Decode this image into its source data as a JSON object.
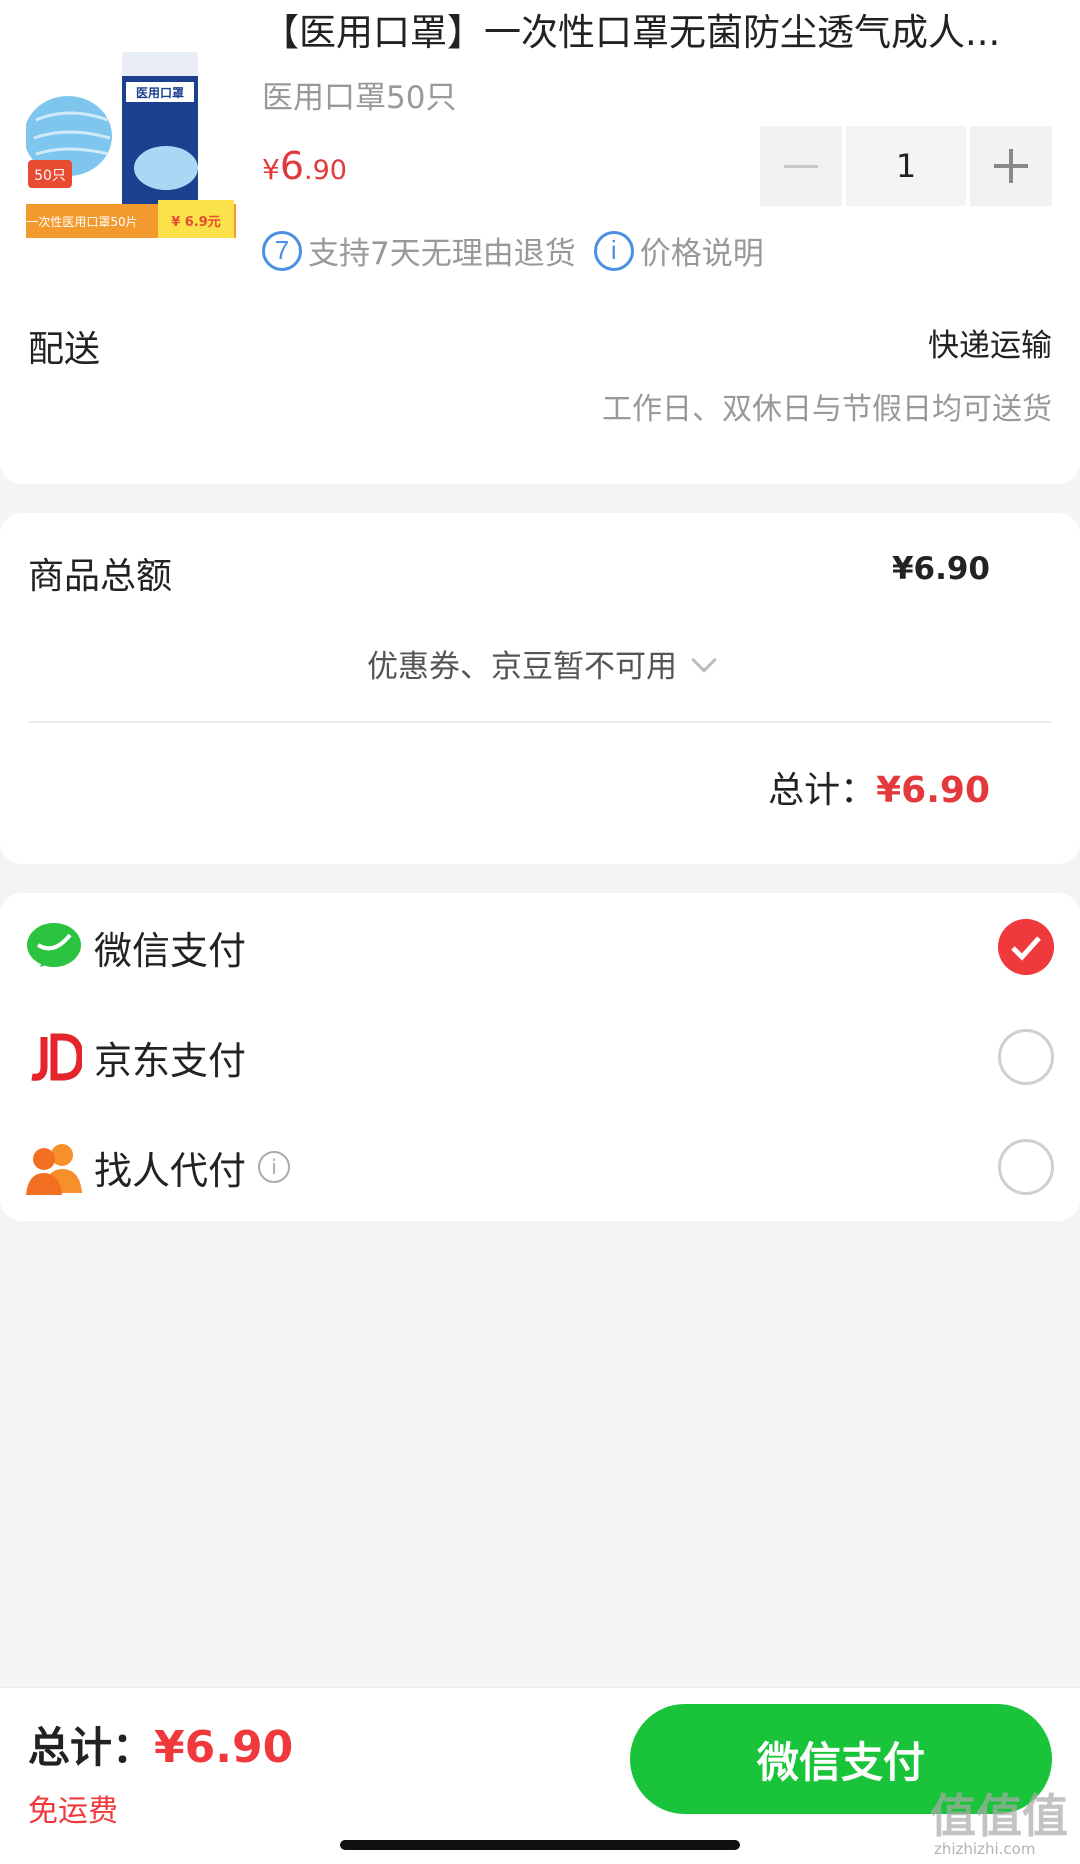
{
  "product": {
    "image": {
      "box_label": "医用口罩",
      "count_badge": "50只",
      "banner_text": "一次性医用口罩50片",
      "price_tag": "¥ 6.9元"
    },
    "title": "【医用口罩】一次性口罩无菌防尘透气成人...",
    "spec": "医用口罩50只",
    "price_currency": "¥",
    "price_int": "6",
    "price_dec": ".90",
    "quantity": "1",
    "return_badge": "7",
    "return_policy": "支持7天无理由退货",
    "price_note_icon": "i",
    "price_note": "价格说明"
  },
  "delivery": {
    "label": "配送",
    "method": "快递运输",
    "desc": "工作日、双休日与节假日均可送货"
  },
  "amount": {
    "label": "商品总额",
    "value": "¥6.90",
    "coupon_text": "优惠券、京豆暂不可用",
    "total_label": "总计：",
    "total_value": "¥6.90"
  },
  "payment": {
    "methods": [
      {
        "label": "微信支付",
        "icon": "wechat-icon",
        "selected": true
      },
      {
        "label": "京东支付",
        "icon": "jd-icon",
        "selected": false
      },
      {
        "label": "找人代付",
        "icon": "friends-icon",
        "selected": false
      }
    ],
    "info_icon": "i"
  },
  "bottom": {
    "total_label": "总计：",
    "total_value": "¥6.90",
    "shipping": "免运费",
    "pay_button": "微信支付"
  },
  "watermark": {
    "text": "值值值",
    "url": "zhizhizhi.com"
  },
  "colors": {
    "accent_red": "#e4393c",
    "wechat_green": "#19c33a",
    "link_blue": "#4a90e2"
  }
}
